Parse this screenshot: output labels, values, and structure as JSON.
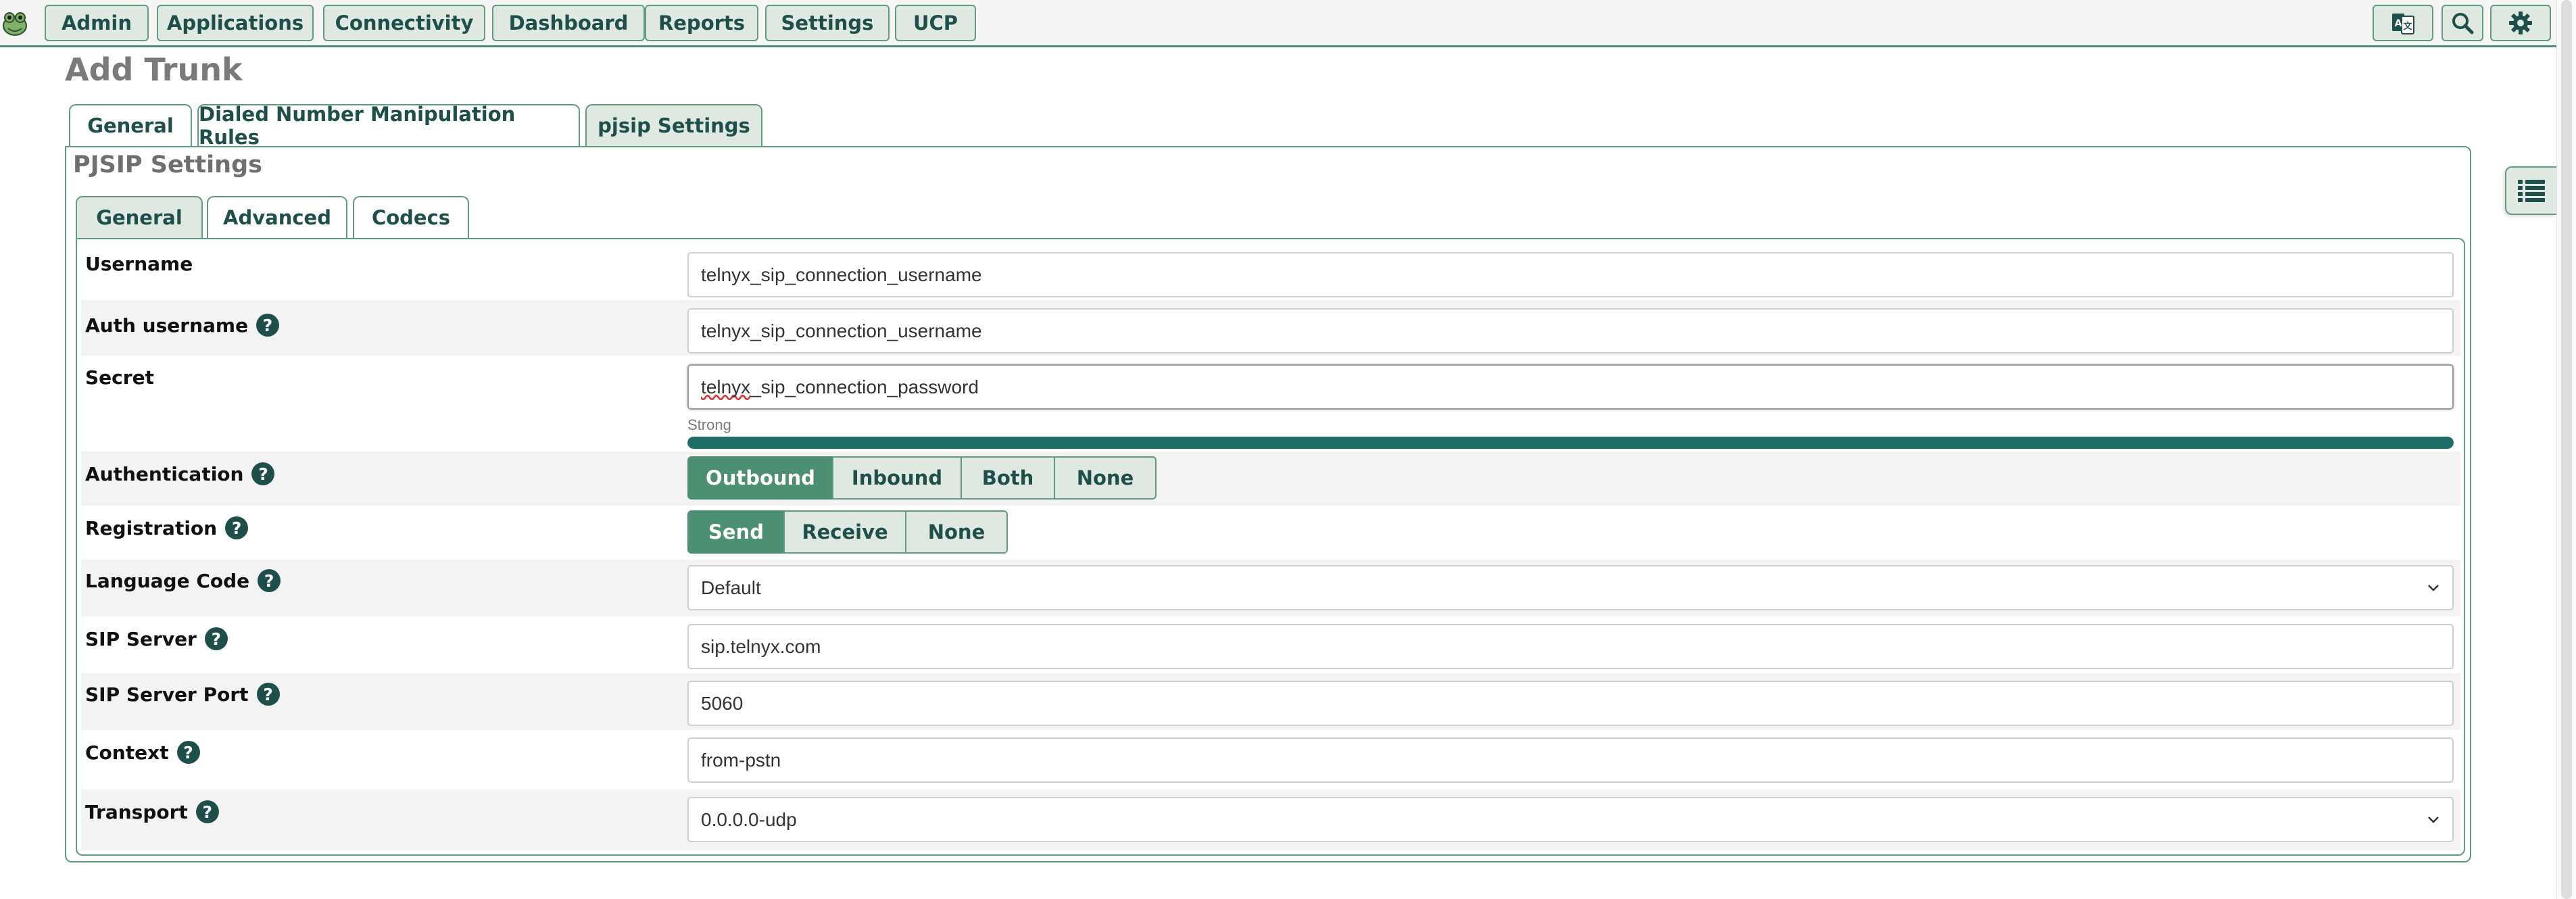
{
  "nav": {
    "items": [
      "Admin",
      "Applications",
      "Connectivity",
      "Dashboard",
      "Reports",
      "Settings",
      "UCP"
    ]
  },
  "page": {
    "title": "Add Trunk"
  },
  "tabs": [
    "General",
    "Dialed Number Manipulation Rules",
    "pjsip Settings"
  ],
  "active_tab": "pjsip Settings",
  "pjsip": {
    "title": "PJSIP Settings",
    "subtabs": [
      "General",
      "Advanced",
      "Codecs"
    ],
    "active_subtab": "General"
  },
  "form": {
    "username": {
      "label": "Username",
      "value": "telnyx_sip_connection_username"
    },
    "auth_username": {
      "label": "Auth username",
      "value": "telnyx_sip_connection_username"
    },
    "secret": {
      "label": "Secret",
      "value_prefix": "telnyx",
      "value_rest": "_sip_connection_password",
      "strength_label": "Strong",
      "strength_level": 1.0
    },
    "authentication": {
      "label": "Authentication",
      "options": [
        "Outbound",
        "Inbound",
        "Both",
        "None"
      ],
      "selected": "Outbound"
    },
    "registration": {
      "label": "Registration",
      "options": [
        "Send",
        "Receive",
        "None"
      ],
      "selected": "Send"
    },
    "language_code": {
      "label": "Language Code",
      "value": "Default"
    },
    "sip_server": {
      "label": "SIP Server",
      "value": "sip.telnyx.com"
    },
    "sip_server_port": {
      "label": "SIP Server Port",
      "value": "5060"
    },
    "context": {
      "label": "Context",
      "value": "from-pstn"
    },
    "transport": {
      "label": "Transport",
      "value": "0.0.0.0-udp"
    }
  },
  "help_glyph": "?",
  "icons": {
    "logo": "frog-logo-icon",
    "translate": "translate-icon",
    "search": "search-icon",
    "settings": "gear-icon",
    "sidebar": "list-icon",
    "dropdown": "chevron-down-icon",
    "help": "question-circle-icon"
  },
  "colors": {
    "accent": "#4c8f72",
    "accent_dark": "#1f4f4a",
    "button_bg": "#dfe9e1",
    "strength_fill": "#1d6f66"
  }
}
